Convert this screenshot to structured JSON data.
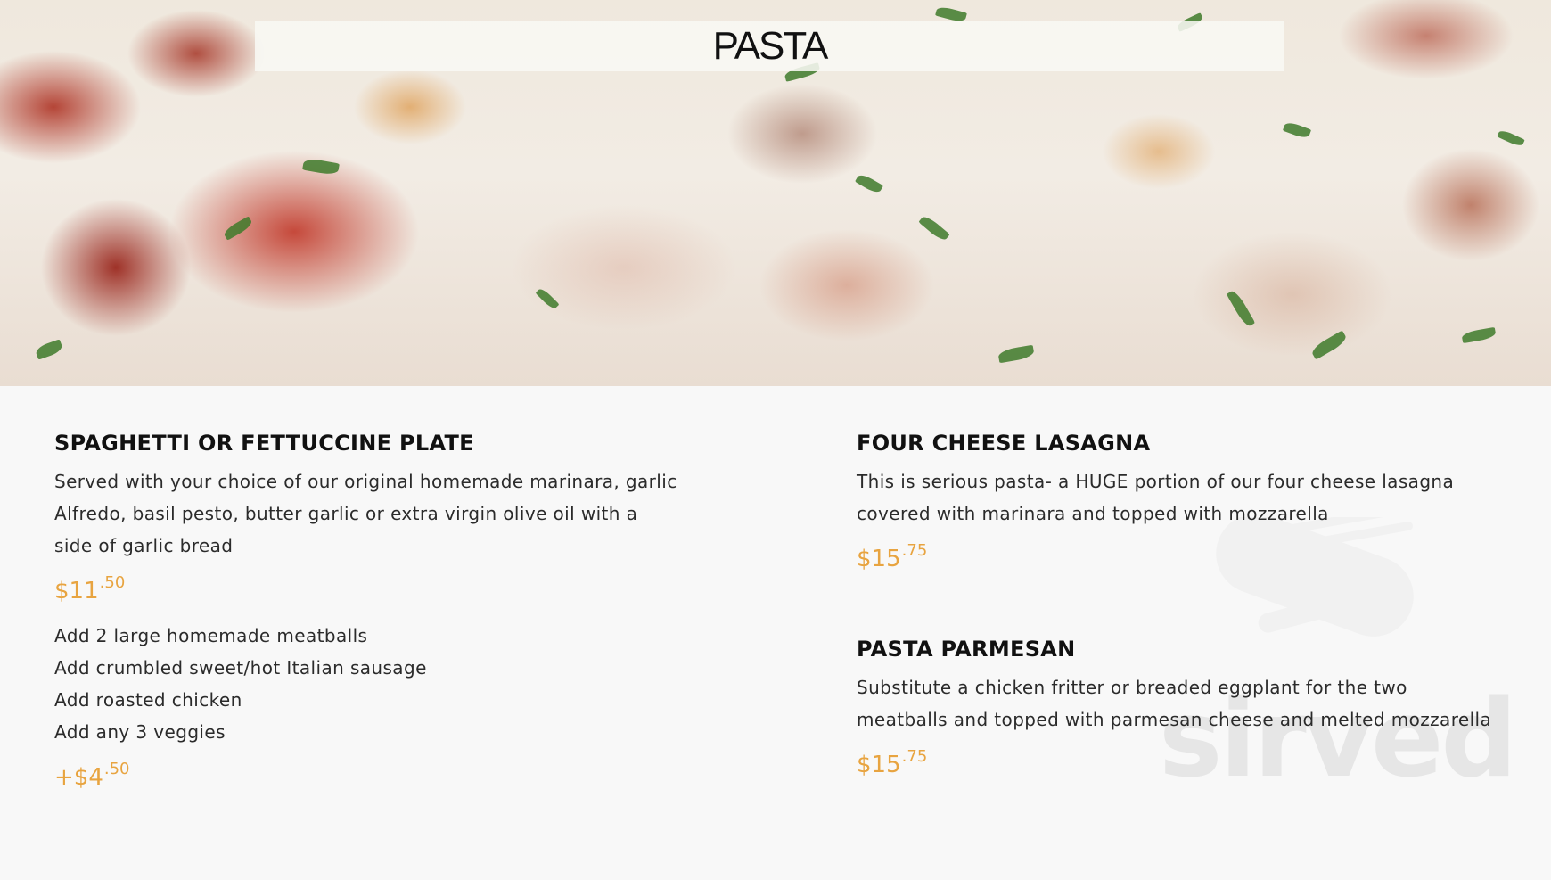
{
  "header": {
    "title": "PASTA"
  },
  "items": [
    {
      "name": "SPAGHETTI OR FETTUCCINE PLATE",
      "description": "Served with your choice of our original homemade marinara, garlic Alfredo, basil pesto, butter garlic or extra virgin olive oil with a side of garlic bread",
      "price": {
        "main": "$11",
        "cents": ".50"
      },
      "addons": [
        "Add 2 large homemade meatballs",
        "Add crumbled sweet/hot Italian sausage",
        "Add roasted chicken",
        "Add any 3 veggies"
      ],
      "addon_price": {
        "main": "+$4",
        "cents": ".50"
      }
    },
    {
      "name": "FOUR CHEESE LASAGNA",
      "description": "This is serious pasta- a HUGE portion of our four cheese lasagna covered with marinara and topped with mozzarella",
      "price": {
        "main": "$15",
        "cents": ".75"
      }
    },
    {
      "name": "PASTA PARMESAN",
      "description": "Substitute a chicken fritter or breaded eggplant for the two meatballs and topped with parmesan cheese and melted mozzarella",
      "price": {
        "main": "$15",
        "cents": ".75"
      }
    }
  ],
  "watermark": {
    "text": "sirved",
    "icon": "knife-fork-icon"
  },
  "colors": {
    "price": "#e8a440",
    "background": "#f8f8f8",
    "heading": "#111111"
  }
}
